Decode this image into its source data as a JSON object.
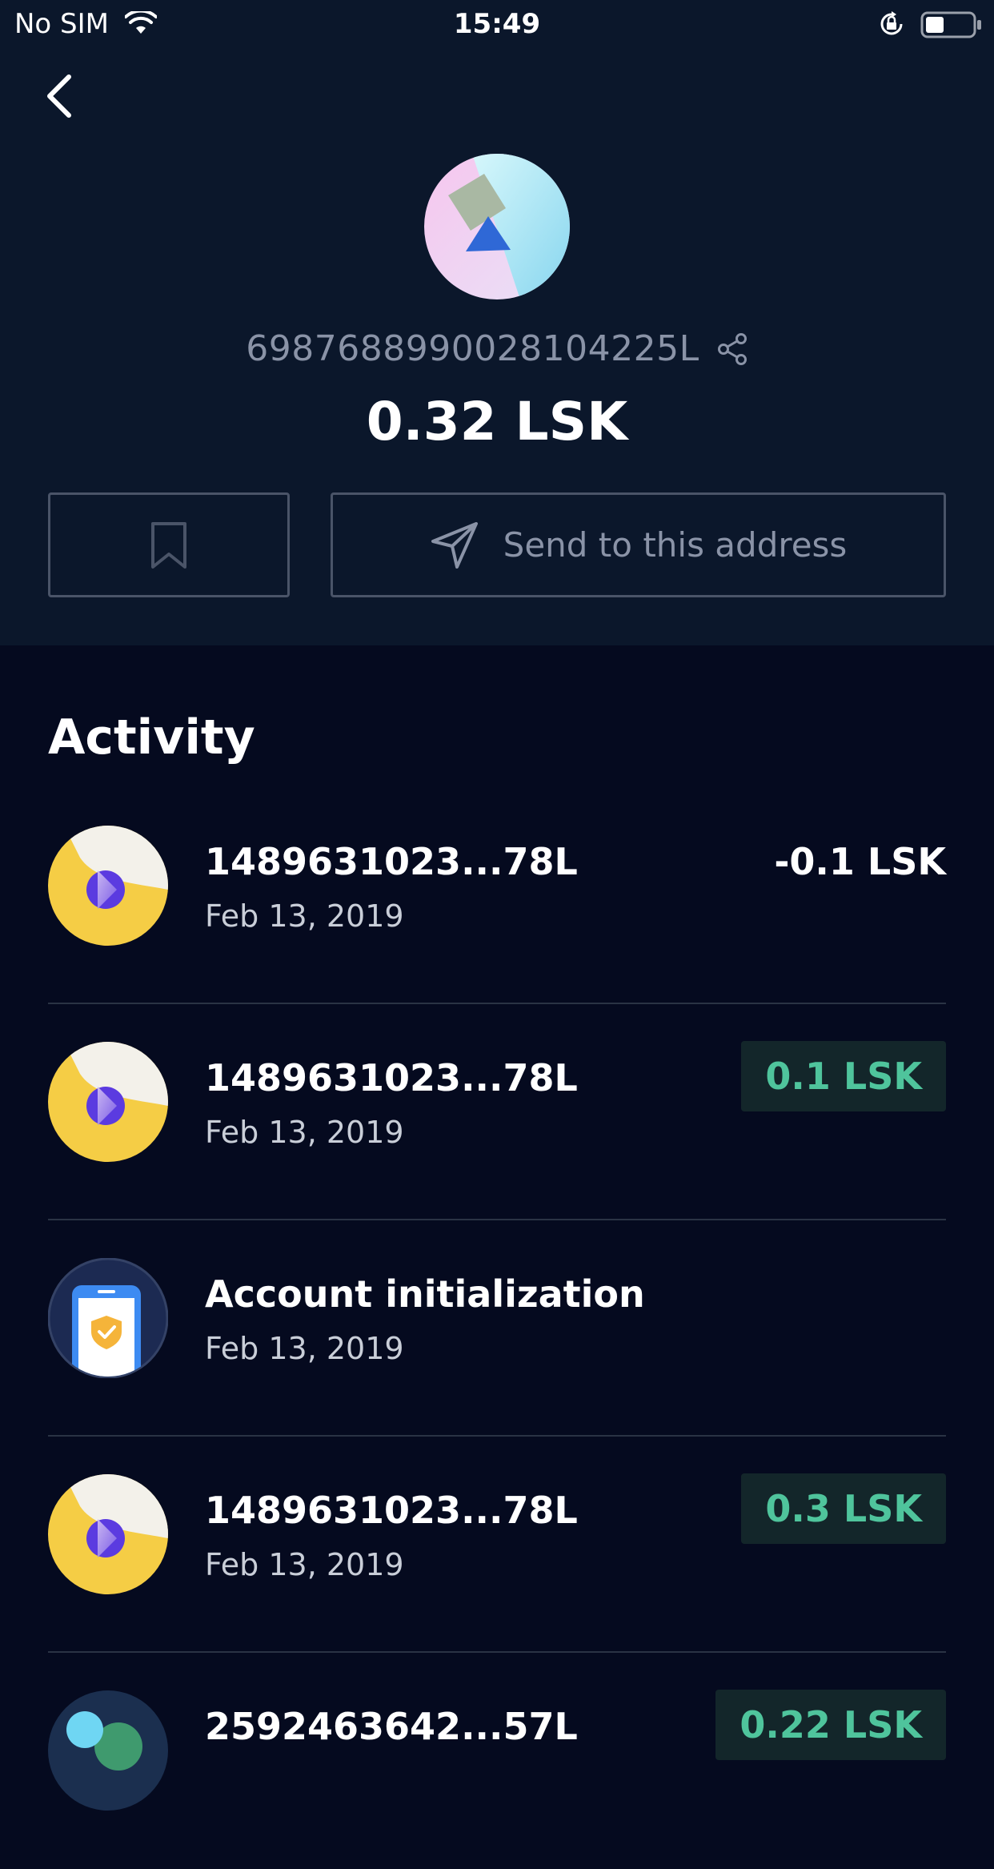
{
  "status_bar": {
    "carrier": "No SIM",
    "time": "15:49"
  },
  "account": {
    "address": "6987688990028104225L",
    "balance": "0.32 LSK"
  },
  "actions": {
    "send_label": "Send to this address"
  },
  "activity": {
    "title": "Activity",
    "items": [
      {
        "address": "1489631023...78L",
        "date": "Feb 13, 2019",
        "amount": "-0.1 LSK",
        "direction": "outgoing"
      },
      {
        "address": "1489631023...78L",
        "date": "Feb 13, 2019",
        "amount": "0.1 LSK",
        "direction": "incoming"
      },
      {
        "address": "Account initialization",
        "date": "Feb 13, 2019",
        "amount": "",
        "direction": "initialization"
      },
      {
        "address": "1489631023...78L",
        "date": "Feb 13, 2019",
        "amount": "0.3 LSK",
        "direction": "incoming"
      },
      {
        "address": "2592463642...57L",
        "date": "",
        "amount": "0.22 LSK",
        "direction": "incoming"
      }
    ]
  },
  "colors": {
    "header_bg": "#0b172b",
    "page_bg": "#050a1f",
    "incoming_green": "#4fc49c",
    "muted_text": "#8a93a7"
  }
}
